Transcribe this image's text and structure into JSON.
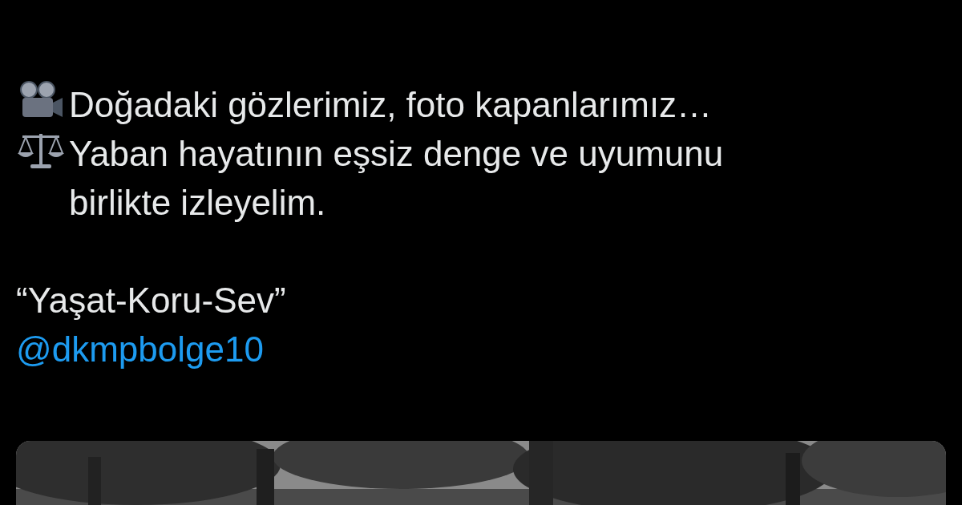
{
  "tweet": {
    "lines": [
      {
        "kind": "projector",
        "text": "Doğadaki gözlerimiz, foto kapanlarımız…"
      },
      {
        "kind": "scales",
        "text": "Yaban hayatının eşsiz denge ve uyumunu birlikte izleyelim."
      }
    ],
    "motto": "“Yaşat-Koru-Sev”",
    "mention": "@dkmpbolge10"
  }
}
